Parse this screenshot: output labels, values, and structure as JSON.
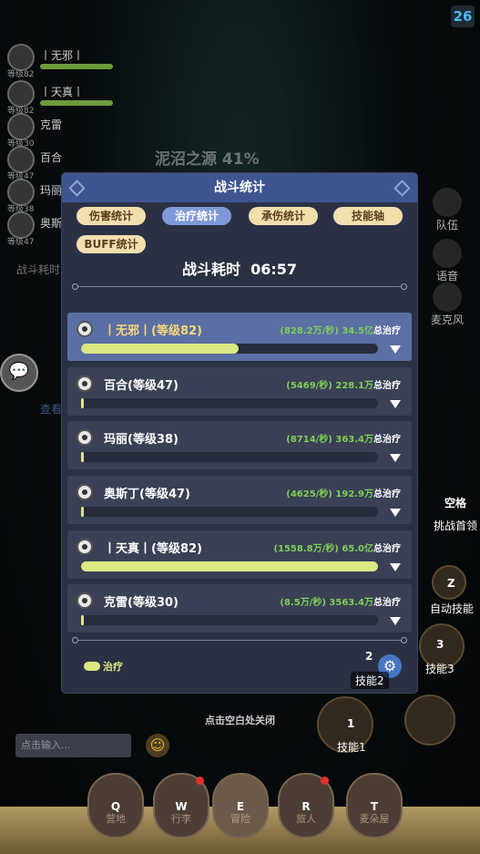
{
  "top_counter": "26",
  "party": [
    {
      "name": "丨无邪丨",
      "level": "等级82"
    },
    {
      "name": "丨天真丨",
      "level": "等级82"
    },
    {
      "name": "克雷",
      "level": "等级30"
    },
    {
      "name": "百合",
      "level": "等级47"
    },
    {
      "name": "玛丽",
      "level": "等级38"
    },
    {
      "name": "奥斯",
      "level": "等级47"
    }
  ],
  "boss": {
    "name": "泥沼之源",
    "percent": "41%"
  },
  "side_buttons": {
    "team": "队伍",
    "voice": "语音",
    "mic": "麦克风"
  },
  "modal": {
    "title": "战斗统计",
    "tabs": [
      "伤害统计",
      "治疗统计",
      "承伤统计",
      "技能轴",
      "BUFF统计"
    ],
    "active_tab": "治疗统计",
    "duration_label": "战斗耗时",
    "duration": "06:57",
    "rows": [
      {
        "name": "丨无邪丨(等级82)",
        "rate": "(828.2万/秒)",
        "total": "34.5亿",
        "tag": "总治疗",
        "fill": 0.53
      },
      {
        "name": "百合(等级47)",
        "rate": "(5469/秒)",
        "total": "228.1万",
        "tag": "总治疗",
        "fill": 0.0
      },
      {
        "name": "玛丽(等级38)",
        "rate": "(8714/秒)",
        "total": "363.4万",
        "tag": "总治疗",
        "fill": 0.0
      },
      {
        "name": "奥斯丁(等级47)",
        "rate": "(4625/秒)",
        "total": "192.9万",
        "tag": "总治疗",
        "fill": 0.0
      },
      {
        "name": "丨天真丨(等级82)",
        "rate": "(1558.8万/秒)",
        "total": "65.0亿",
        "tag": "总治疗",
        "fill": 1.0
      },
      {
        "name": "克雷(等级30)",
        "rate": "(8.5万/秒)",
        "total": "3563.4万",
        "tag": "总治疗",
        "fill": 0.01
      }
    ],
    "legend": "治疗",
    "gear_icon": "gear-icon"
  },
  "close_hint": "点击空白处关闭",
  "chat_placeholder": "点击输入...",
  "keys": {
    "space": "空格",
    "challenge": "挑战首领",
    "z": "Z",
    "auto_skill": "自动技能",
    "k3": "3",
    "skill3": "技能3",
    "k2": "2",
    "skill2": "技能2",
    "k1": "1",
    "skill1": "技能1"
  },
  "nav": [
    {
      "key": "Q",
      "label": "营地"
    },
    {
      "key": "W",
      "label": "行李"
    },
    {
      "key": "E",
      "label": "冒险"
    },
    {
      "key": "R",
      "label": "旅人"
    },
    {
      "key": "T",
      "label": "麦朵屋"
    }
  ],
  "left_misc": {
    "battle_stats": "战斗耗时",
    "view": "查看"
  }
}
